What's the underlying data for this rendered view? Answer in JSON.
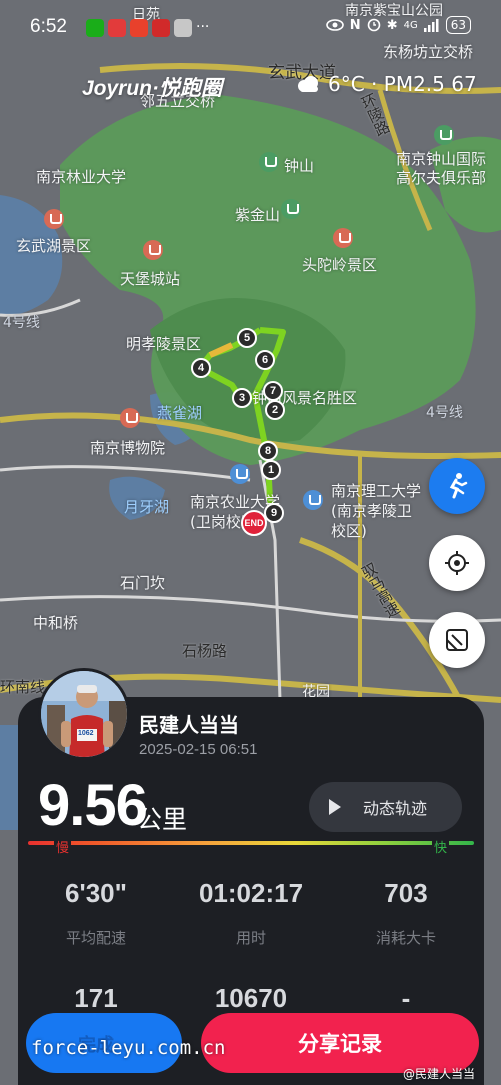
{
  "status_bar": {
    "time": "6:52",
    "network": "4G",
    "battery": "63",
    "brand_colors": [
      "#1aad19",
      "#e23b3b",
      "#e8412c",
      "#d12a2a",
      "#c7c7c7"
    ]
  },
  "header": {
    "app_brand": "Joyrun·悦跑圈",
    "weather": "6°C · PM2.5 67"
  },
  "map": {
    "labels": {
      "ribbon": "日苑",
      "lake_top": "南京紫宝山公园",
      "dongyang": "东杨坊立交桥",
      "xuanwu_ave": "玄武大道",
      "wuwu": "邻五立交桥",
      "huanling": "环陵路",
      "forestry_univ": "南京林业大学",
      "zhongshan": "钟山",
      "golf": "南京钟山国际高尔夫俱乐部",
      "zijinshan": "紫金山",
      "xuanwuhu": "玄武湖景区",
      "toutuoling": "头陀岭景区",
      "tianbao": "天堡城站",
      "mingxiaoling": "明孝陵景区",
      "scenic": "钟山风景名胜区",
      "yanque": "燕雀湖",
      "museum": "南京博物院",
      "yueya": "月牙湖",
      "agri_univ": "南京农业大学(卫岗校区)",
      "tech_univ": "南京理工大学(南京孝陵卫校区)",
      "shimenkan": "石门坎",
      "zhonghe": "中和桥",
      "shiyang": "石杨路",
      "yutian": "驭马高速",
      "huanan": "环南线",
      "huayuan": "花园",
      "road4": "4号线",
      "road_right": "4号线",
      "rivers": "南京"
    },
    "markers": [
      "1",
      "2",
      "3",
      "4",
      "5",
      "6",
      "7",
      "8",
      "9"
    ],
    "end_label": "END",
    "fab_icons": [
      "runner-mode-icon",
      "locate-icon",
      "screenshot-icon"
    ]
  },
  "card": {
    "user_name": "民建人当当",
    "date": "2025-02-15 06:51",
    "distance": "9.56",
    "distance_unit": "公里",
    "replay_label": "动态轨迹",
    "slow_label": "慢",
    "fast_label": "快",
    "stats": [
      {
        "value": "6'30\"",
        "label": "平均配速"
      },
      {
        "value": "01:02:17",
        "label": "用时"
      },
      {
        "value": "703",
        "label": "消耗大卡"
      }
    ],
    "stats2": [
      {
        "value": "171"
      },
      {
        "value": "10670"
      },
      {
        "value": "-"
      }
    ],
    "left_button_hidden_text": "完成",
    "share_label": "分享记录",
    "avatar_bib": "1062"
  },
  "watermarks": {
    "url": "force-leyu.com.cn",
    "weibo": "@民建人当当"
  },
  "colors": {
    "accent_red": "#f2224e",
    "accent_blue": "#1778f2",
    "route_green": "#7ed321",
    "route_yellow": "#e8b83a"
  }
}
